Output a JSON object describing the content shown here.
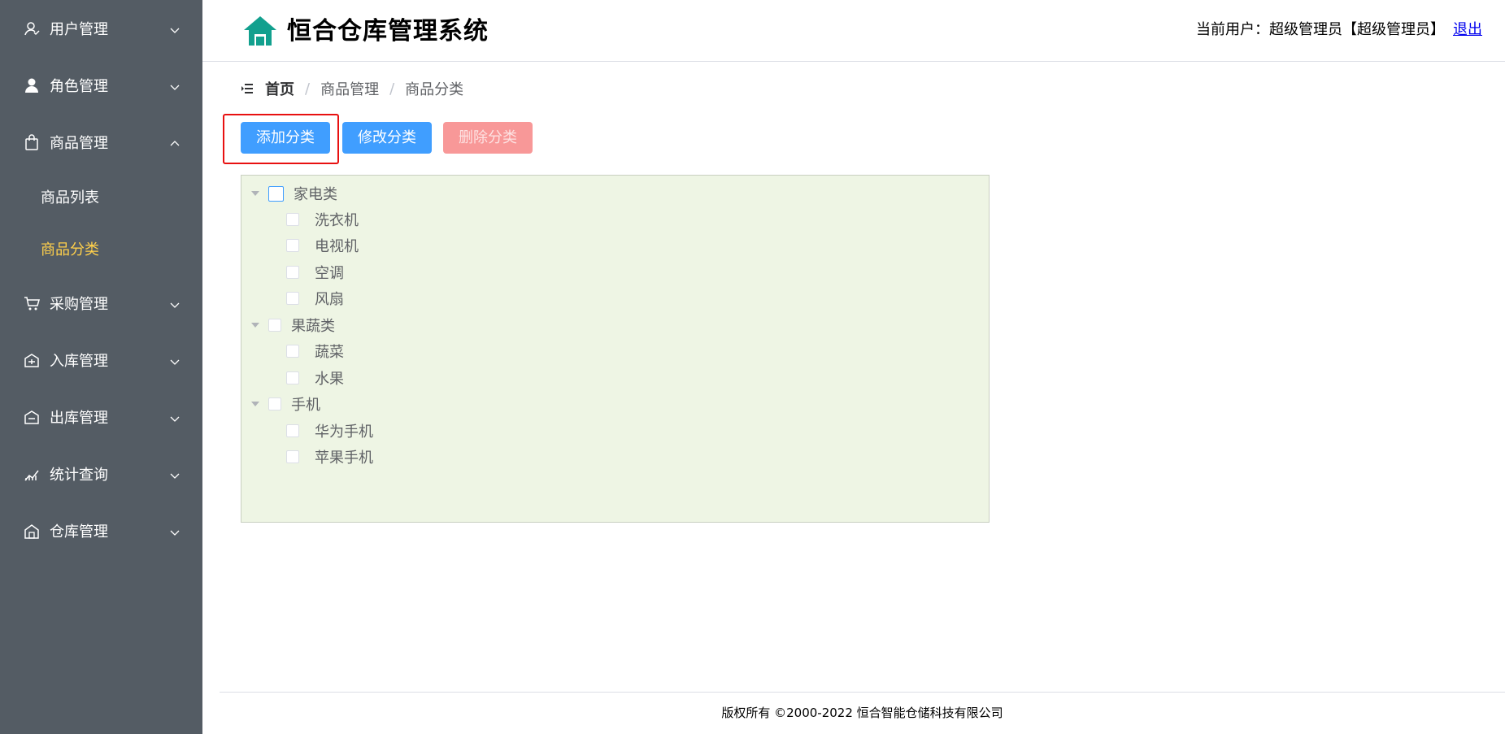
{
  "sidebar": {
    "items": [
      {
        "label": "用户管理",
        "icon": "user-icon"
      },
      {
        "label": "角色管理",
        "icon": "person-icon"
      },
      {
        "label": "商品管理",
        "icon": "bag-icon"
      },
      {
        "label": "采购管理",
        "icon": "cart-icon"
      },
      {
        "label": "入库管理",
        "icon": "stock-in-icon"
      },
      {
        "label": "出库管理",
        "icon": "stock-out-icon"
      },
      {
        "label": "统计查询",
        "icon": "trend-chart-icon"
      },
      {
        "label": "仓库管理",
        "icon": "warehouse-icon"
      }
    ],
    "submenu": [
      {
        "label": "商品列表"
      },
      {
        "label": "商品分类"
      }
    ],
    "active_color": "#ffd04b",
    "background": "#545c64"
  },
  "header": {
    "title": "恒合仓库管理系统",
    "user_prefix": "当前用户：超级管理员【超级管理员】",
    "logout": "退出"
  },
  "breadcrumb": {
    "home": "首页",
    "sep": "/",
    "level1": "商品管理",
    "level2": "商品分类"
  },
  "toolbar": {
    "add_label": "添加分类",
    "edit_label": "修改分类",
    "delete_label": "删除分类"
  },
  "tree": {
    "groups": [
      {
        "label": "家电类",
        "children": [
          "洗衣机",
          "电视机",
          "空调",
          "风扇"
        ]
      },
      {
        "label": "果蔬类",
        "children": [
          "蔬菜",
          "水果"
        ]
      },
      {
        "label": "手机",
        "children": [
          "华为手机",
          "苹果手机"
        ]
      }
    ]
  },
  "footer": {
    "text": "版权所有 ©2000-2022  恒合智能仓储科技有限公司"
  },
  "colors": {
    "primary": "#409eff",
    "danger_disabled": "#f89898",
    "tree_bg": "#eef5e4",
    "highlight": "#e81010",
    "logo": "#12a08e"
  }
}
